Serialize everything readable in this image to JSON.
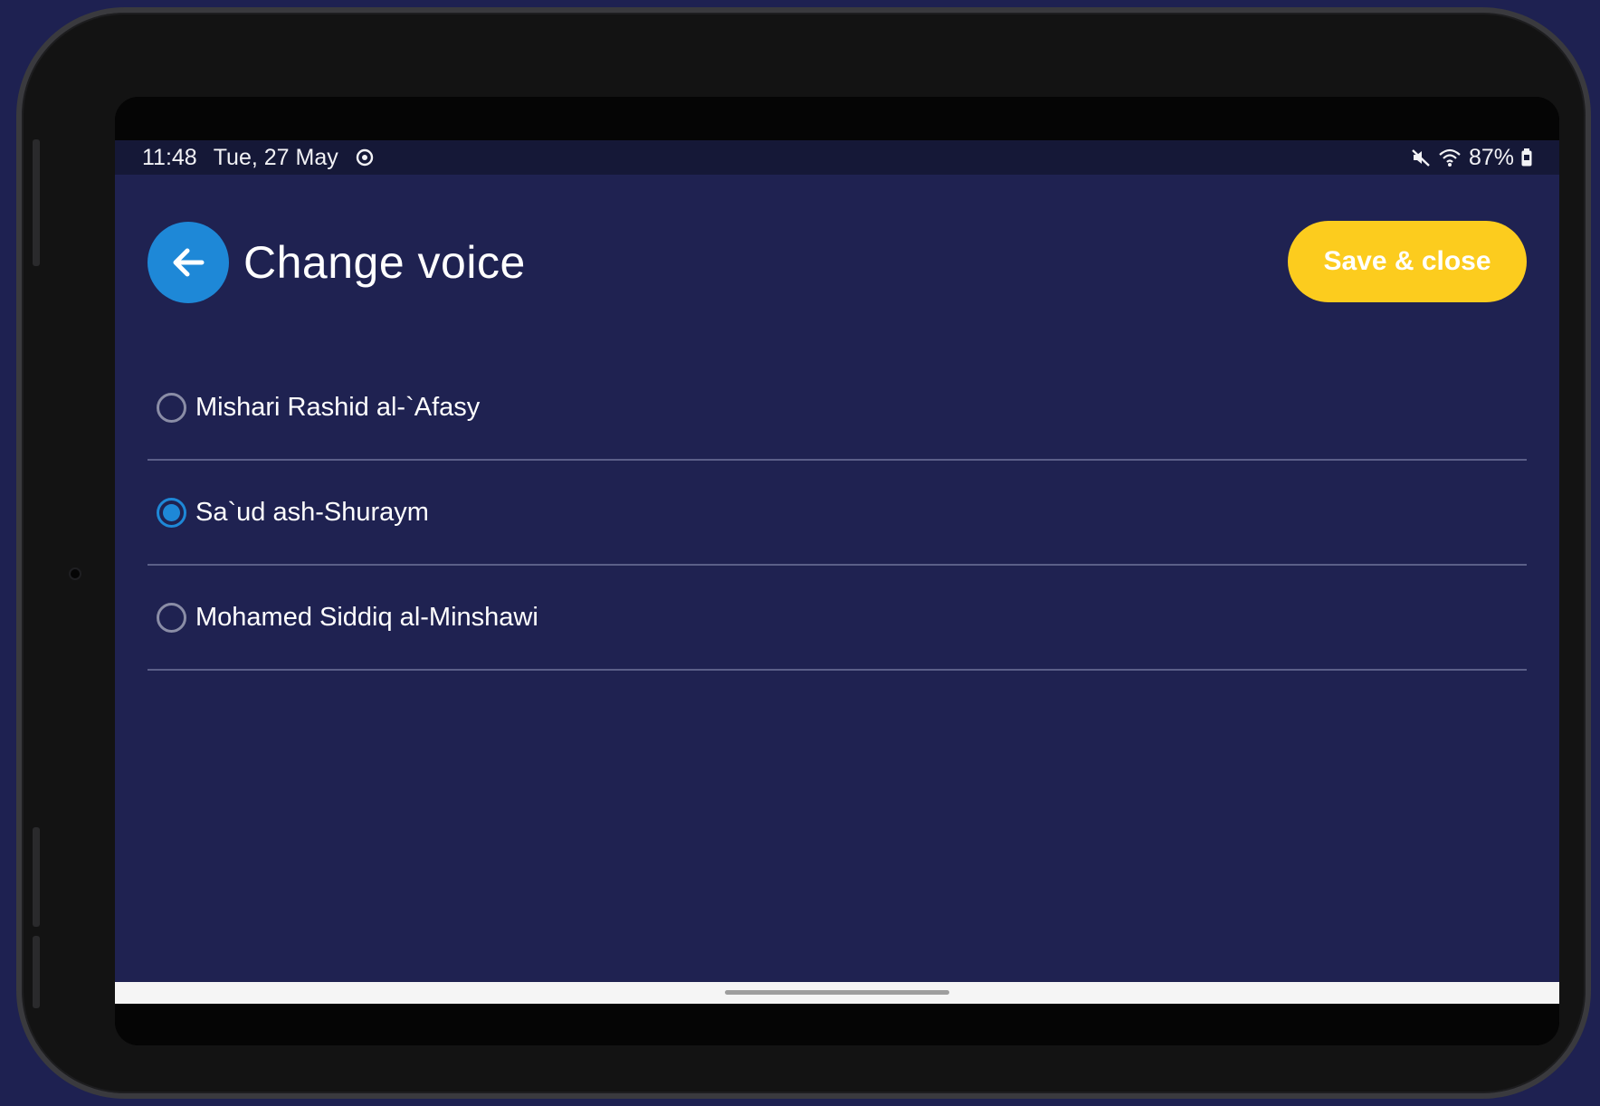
{
  "status_bar": {
    "time": "11:48",
    "date": "Tue, 27 May",
    "battery": "87%",
    "icons": [
      "sync-icon",
      "mute-icon",
      "wifi-icon",
      "battery-icon"
    ]
  },
  "header": {
    "title": "Change voice",
    "back_icon": "arrow-left-icon",
    "save_label": "Save & close"
  },
  "voices": {
    "items": [
      {
        "label": "Mishari Rashid al-`Afasy",
        "selected": false
      },
      {
        "label": "Sa`ud ash-Shuraym",
        "selected": true
      },
      {
        "label": "Mohamed Siddiq al-Minshawi",
        "selected": false
      }
    ]
  },
  "colors": {
    "background": "#1f2251",
    "accent": "#1e88d7",
    "save_button": "#fccc1e"
  }
}
